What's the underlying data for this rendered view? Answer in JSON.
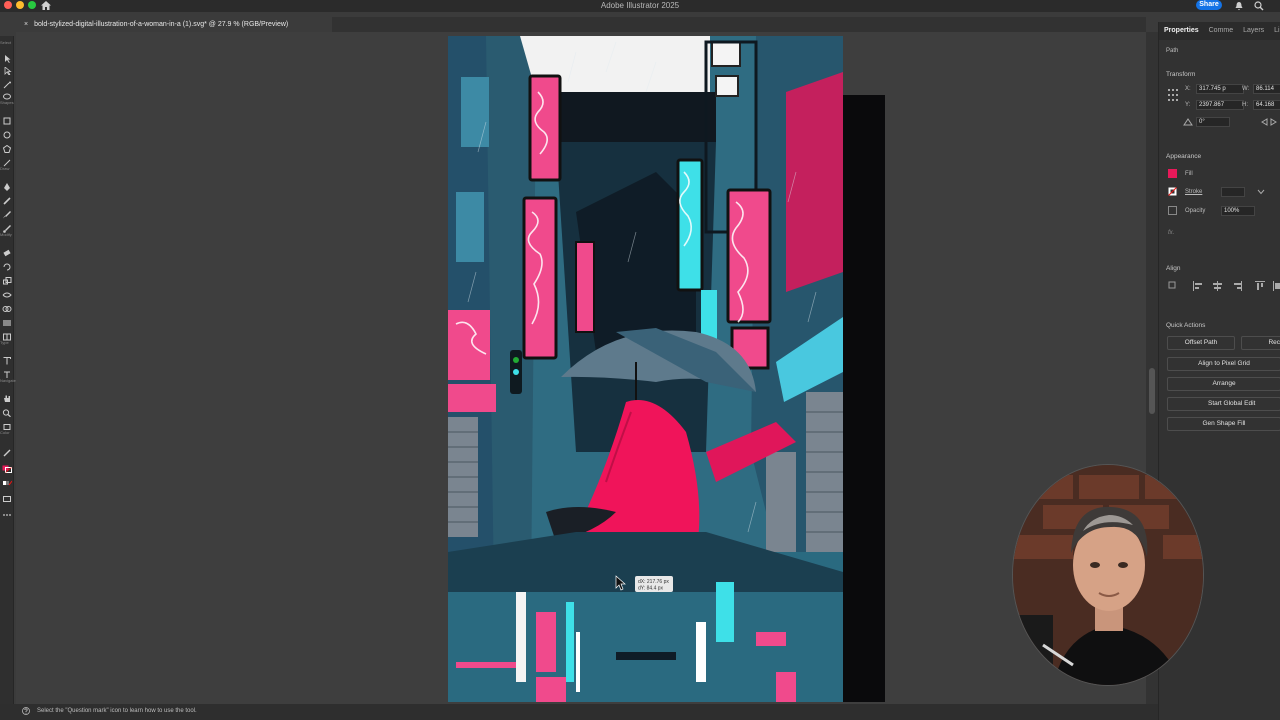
{
  "app": {
    "title": "Adobe Illustrator 2025",
    "share_label": "Share",
    "window_controls": [
      "#ff5f57",
      "#febc2e",
      "#28c840"
    ]
  },
  "document": {
    "tab_title": "bold-stylized-digital-illustration-of-a-woman-in-a (1).svg* @ 27.9 % (RGB/Preview)",
    "close_glyph": "×"
  },
  "toolbar": {
    "labels": [
      "Select",
      "Shapes",
      "Draw",
      "Modify",
      "Type",
      "Navigate",
      "Color"
    ]
  },
  "canvas": {
    "tooltip_dx": "dX: 217.76 px",
    "tooltip_dy": "dY: 84.4 px",
    "artwork_colors": {
      "sky": "#f2f2f2",
      "blue": "#2f6c82",
      "dark": "#131a22",
      "pink": "#f0145a",
      "cyan": "#3ee0e8"
    }
  },
  "status": {
    "text": "Select the \"Question mark\" icon to learn how to use the tool."
  },
  "panel": {
    "tabs": [
      "Properties",
      "Comme",
      "Layers",
      "Libr"
    ],
    "selection_type": "Path",
    "transform": {
      "heading": "Transform",
      "x_label": "X:",
      "x_value": "317.745 p",
      "y_label": "Y:",
      "y_value": "2397.867",
      "w_label": "W:",
      "w_value": "86.114",
      "h_label": "H:",
      "h_value": "64.168",
      "rotate_value": "0°"
    },
    "appearance": {
      "heading": "Appearance",
      "fill_label": "Fill",
      "fill_color": "#e8195a",
      "stroke_label": "Stroke",
      "opacity_label": "Opacity",
      "opacity_value": "100%",
      "fx_label": "fx."
    },
    "align": {
      "heading": "Align"
    },
    "quick_actions": {
      "heading": "Quick Actions",
      "offset_path": "Offset Path",
      "recolor": "Rec",
      "align_pixel": "Align to Pixel Grid",
      "arrange": "Arrange",
      "global_edit": "Start Global Edit",
      "gen_shape": "Gen Shape Fill"
    }
  }
}
